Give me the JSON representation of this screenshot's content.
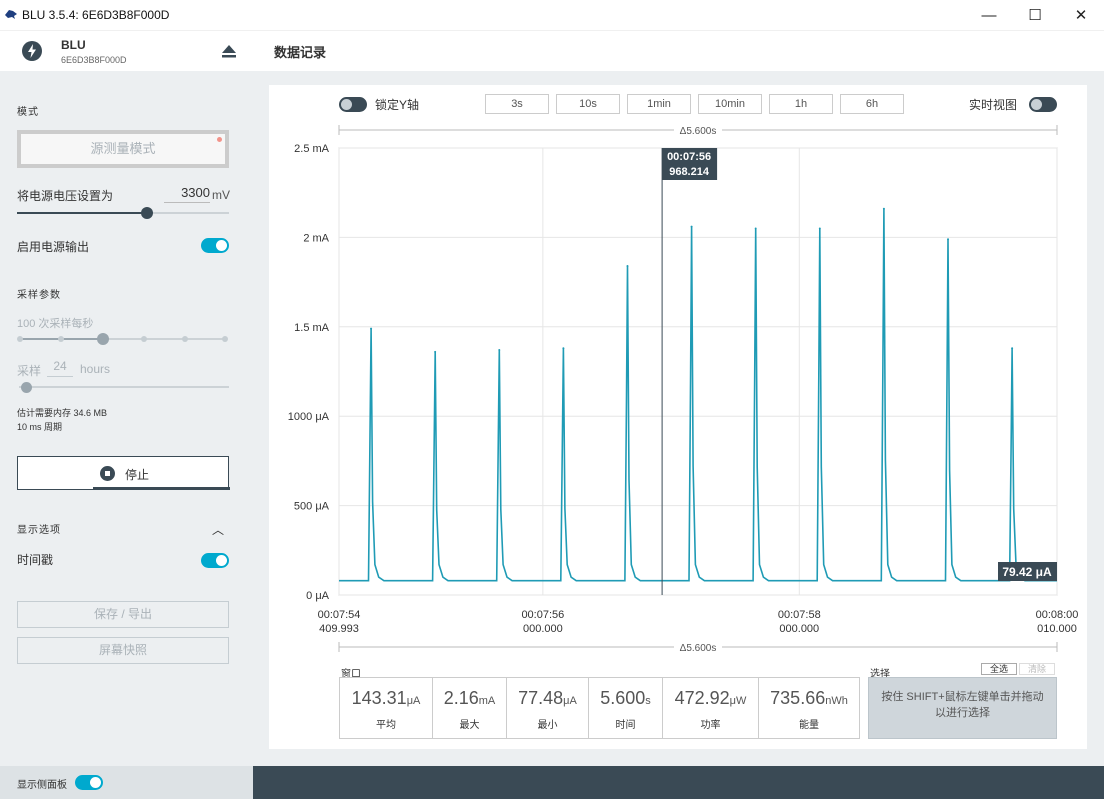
{
  "window": {
    "title": "BLU 3.5.4: 6E6D3B8F000D",
    "minimize": "—",
    "maximize": "☐",
    "close": "✕"
  },
  "device": {
    "name": "BLU",
    "serial": "6E6D3B8F000D"
  },
  "sidebar": {
    "mode_title": "模式",
    "mode_button": "源测量模式",
    "voltage_label": "将电源电压设置为",
    "voltage_value": "3300",
    "voltage_unit": "mV",
    "voltage_level": 0.61,
    "power_output_label": "启用电源输出",
    "power_output_on": true,
    "sampling_title": "采样参数",
    "rate_label": "100 次采样每秒",
    "duration_prefix": "采样",
    "duration_value": "24",
    "duration_unit": "hours",
    "memory_text": "估计需要内存 34.6 MB",
    "period_text": "10 ms 周期",
    "stop_label": "停止",
    "display_title": "显示选项",
    "display_chevron": "︿",
    "timestamp_label": "时间戳",
    "timestamp_on": true,
    "save_label": "保存 / 导出",
    "screenshot_label": "屏幕快照",
    "footer_label": "显示侧面板",
    "footer_on": true
  },
  "main": {
    "title": "数据记录"
  },
  "toolbar": {
    "lock_label": "锁定Y轴",
    "lock_on": false,
    "window_buttons": [
      "3s",
      "10s",
      "1min",
      "10min",
      "1h",
      "6h"
    ],
    "realtime_label": "实时视图",
    "realtime_on": false
  },
  "stats": {
    "window_label": "窗口",
    "items": [
      {
        "value": "143.31",
        "unit": "μA",
        "label": "平均"
      },
      {
        "value": "2.16",
        "unit": "mA",
        "label": "最大"
      },
      {
        "value": "77.48",
        "unit": "μA",
        "label": "最小"
      },
      {
        "value": "5.600",
        "unit": "s",
        "label": "时间"
      },
      {
        "value": "472.92",
        "unit": "μW",
        "label": "功率"
      },
      {
        "value": "735.66",
        "unit": "nWh",
        "label": "能量"
      }
    ],
    "selection_label": "选择",
    "select_all": "全选",
    "clear": "清除",
    "selection_hint": "按住 SHIFT+鼠标左键单击并拖动以进行选择"
  },
  "colors": {
    "accent": "#00a9ce",
    "dark": "#3a4a55",
    "sidebar_bg": "#eceff1"
  },
  "chart_data": {
    "type": "line",
    "title": "",
    "xlabel": "",
    "ylabel": "",
    "delta_top": "Δ5.600s",
    "delta_bottom": "Δ5.600s",
    "x_unit": "s",
    "xlim": [
      0.0,
      5.6
    ],
    "ylim_uA": [
      0,
      2500
    ],
    "grid": true,
    "y_ticks": [
      {
        "value": 0,
        "label": "0 μA"
      },
      {
        "value": 500,
        "label": "500 μA"
      },
      {
        "value": 1000,
        "label": "1000 μA"
      },
      {
        "value": 1500,
        "label": "1.5 mA"
      },
      {
        "value": 2000,
        "label": "2 mA"
      },
      {
        "value": 2500,
        "label": "2.5 mA"
      }
    ],
    "x_ticks": [
      {
        "value": 0.0,
        "line1": "00:07:54",
        "line2": "409.993"
      },
      {
        "value": 1.59,
        "line1": "00:07:56",
        "line2": "000.000"
      },
      {
        "value": 3.59,
        "line1": "00:07:58",
        "line2": "000.000"
      },
      {
        "value": 5.6,
        "line1": "00:08:00",
        "line2": "010.000"
      }
    ],
    "baseline_uA": 80,
    "series": [
      {
        "color": "#1f9bb5",
        "pulses": [
          {
            "t": 0.25,
            "peak_uA": 1490
          },
          {
            "t": 0.75,
            "peak_uA": 1360
          },
          {
            "t": 1.25,
            "peak_uA": 1370
          },
          {
            "t": 1.75,
            "peak_uA": 1380
          },
          {
            "t": 2.25,
            "peak_uA": 1840
          },
          {
            "t": 2.75,
            "peak_uA": 2060
          },
          {
            "t": 3.25,
            "peak_uA": 2050
          },
          {
            "t": 3.75,
            "peak_uA": 2050
          },
          {
            "t": 4.25,
            "peak_uA": 2160
          },
          {
            "t": 4.75,
            "peak_uA": 1990
          },
          {
            "t": 5.25,
            "peak_uA": 1380
          }
        ]
      }
    ],
    "cursor": {
      "t": 2.52,
      "time_label": "00:07:56",
      "value_label": "968.214"
    },
    "last_value_label": "79.42 μA"
  }
}
